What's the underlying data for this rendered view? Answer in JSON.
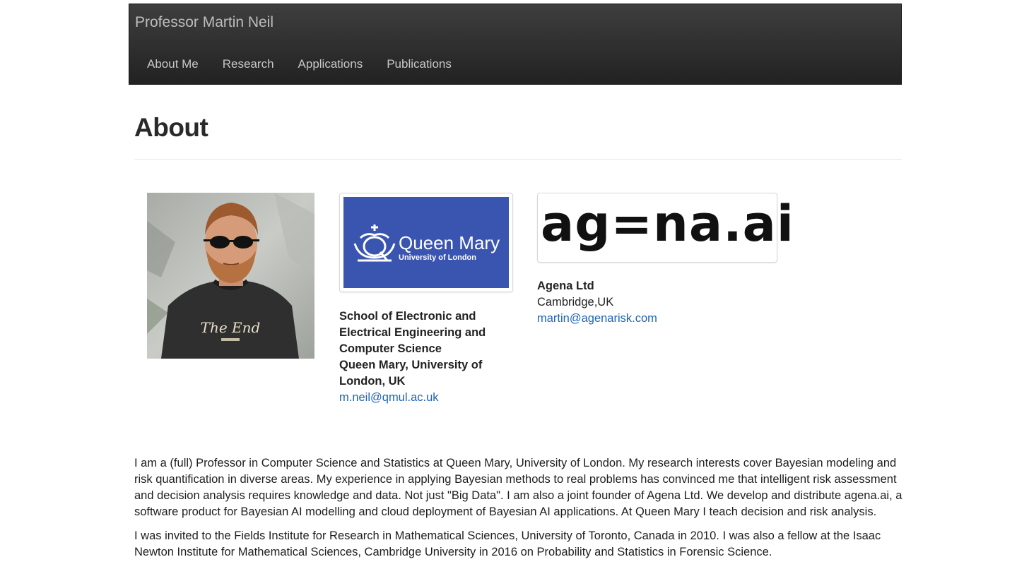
{
  "navbar": {
    "brand": "Professor Martin Neil",
    "items": [
      {
        "label": "About Me"
      },
      {
        "label": "Research"
      },
      {
        "label": "Applications"
      },
      {
        "label": "Publications"
      }
    ]
  },
  "page": {
    "title": "About"
  },
  "profile_photo": {
    "shirt_text": "The End"
  },
  "qmul": {
    "logo_main": "Queen Mary",
    "logo_sub": "University of London",
    "logo_bg_color": "#3a55b0",
    "department_lines": [
      "School of Electronic and",
      "Electrical Engineering and",
      "Computer Science"
    ],
    "institution_lines": [
      "Queen Mary, University of",
      "London, UK"
    ],
    "email": "m.neil@qmul.ac.uk"
  },
  "agena": {
    "logo_text": "ag=na.ai",
    "name": "Agena Ltd",
    "location": "Cambridge,UK",
    "email": "martin@agenarisk.com"
  },
  "bio": {
    "paragraph_1": "I am a (full) Professor in Computer Science and Statistics at Queen Mary, University of London. My research interests cover Bayesian modeling and risk quantification in diverse areas. My experience in applying Bayesian methods to real problems has convinced me that intelligent risk assessment and decision analysis requires knowledge and data. Not just \"Big Data\". I am also a joint founder of Agena Ltd. We develop and distribute agena.ai, a software product for Bayesian AI modelling and cloud deployment of Bayesian AI applications. At Queen Mary I teach decision and risk analysis.",
    "paragraph_2": "I was invited to the Fields Institute for Research in Mathematical Sciences, University of Toronto, Canada in 2010. I was also a fellow at the Isaac Newton Institute for Mathematical Sciences, Cambridge University in 2016 on Probability and Statistics in Forensic Science."
  },
  "colors": {
    "link": "#1d64b5",
    "navbar_bg": "#2c2c2c",
    "nav_text": "#c6c6c6"
  }
}
